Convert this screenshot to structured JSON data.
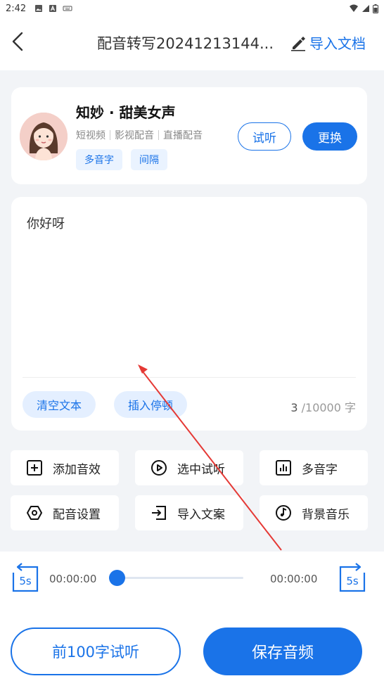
{
  "status_bar": {
    "time": "2:42"
  },
  "header": {
    "title": "配音转写20241213144...",
    "import_label": "导入文档"
  },
  "voice": {
    "name": "知妙 · 甜美女声",
    "tags": [
      "短视频",
      "影视配音",
      "直播配音"
    ],
    "chips": [
      "多音字",
      "间隔"
    ],
    "listen_label": "试听",
    "change_label": "更换"
  },
  "editor": {
    "text": "你好呀",
    "clear_label": "清空文本",
    "insert_pause_label": "插入停顿",
    "count_current": "3",
    "count_suffix": " /10000 字"
  },
  "tools": [
    {
      "label": "添加音效",
      "icon": "plus-square-icon"
    },
    {
      "label": "选中试听",
      "icon": "play-circle-icon"
    },
    {
      "label": "多音字",
      "icon": "bar-chart-icon"
    },
    {
      "label": "配音设置",
      "icon": "hexagon-settings-icon"
    },
    {
      "label": "导入文案",
      "icon": "import-icon"
    },
    {
      "label": "背景音乐",
      "icon": "music-note-icon"
    }
  ],
  "player": {
    "skip_back_label": "5s",
    "skip_forward_label": "5s",
    "current_time": "00:00:00",
    "total_time": "00:00:00",
    "progress": 0
  },
  "actions": {
    "preview_label": "前100字试听",
    "save_label": "保存音频"
  },
  "colors": {
    "accent": "#1a73e8",
    "annotation": "#e53935"
  }
}
